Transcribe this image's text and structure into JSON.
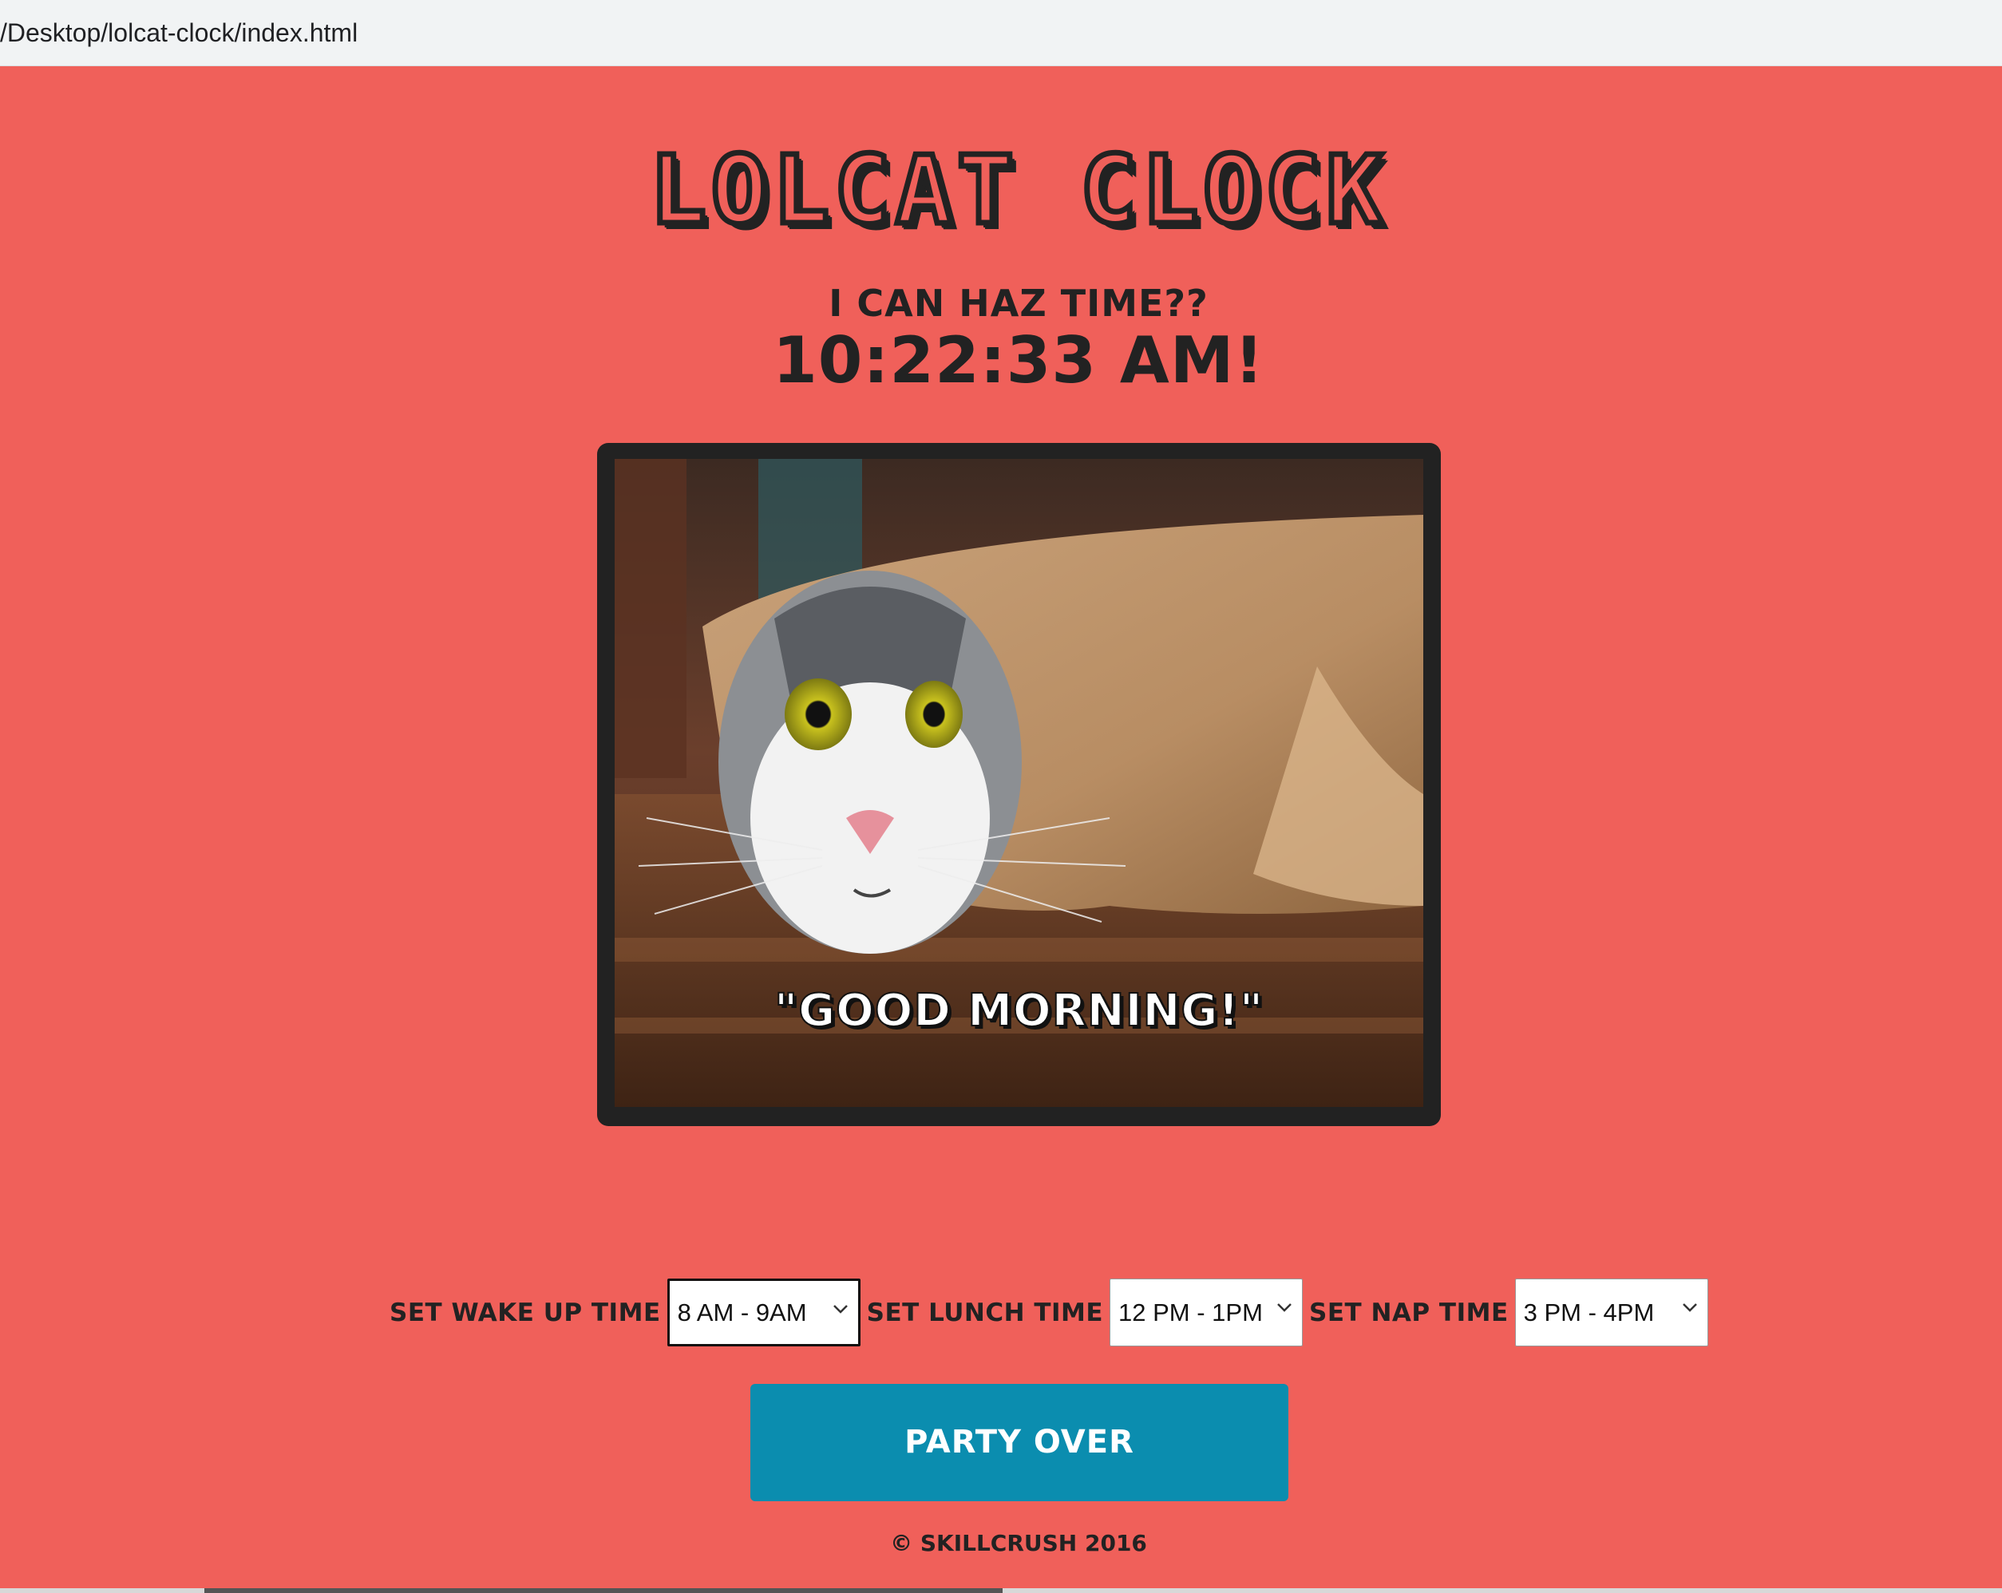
{
  "browser": {
    "url": "/Desktop/lolcat-clock/index.html"
  },
  "page": {
    "title": "Lolcat Clock",
    "subtitle": "I can haz time??",
    "clock_text": "10:22:33 AM!",
    "image": {
      "caption": "\"Good Morning!\""
    },
    "controls": {
      "wake_label": "Set Wake Up Time",
      "wake_value": "8 AM - 9AM",
      "lunch_label": "Set Lunch Time",
      "lunch_value": "12 PM - 1PM",
      "nap_label": "Set Nap Time",
      "nap_value": "3 PM - 4PM"
    },
    "button_label": "Party Over",
    "footer": "© Skillcrush 2016"
  },
  "colors": {
    "background": "#f0605a",
    "button": "#0b8daf",
    "text_dark": "#222222"
  }
}
